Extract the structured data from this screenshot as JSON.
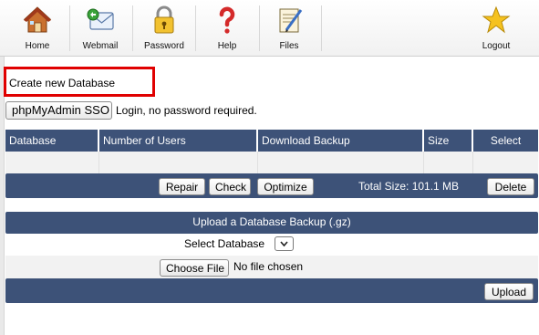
{
  "toolbar": {
    "items": [
      {
        "label": "Home",
        "icon": "home-icon"
      },
      {
        "label": "Webmail",
        "icon": "webmail-icon"
      },
      {
        "label": "Password",
        "icon": "padlock-icon"
      },
      {
        "label": "Help",
        "icon": "question-mark-icon"
      },
      {
        "label": "Files",
        "icon": "files-icon"
      },
      {
        "label": "Logout",
        "icon": "star-icon"
      }
    ]
  },
  "create": {
    "label": "Create new Database",
    "highlight_color": "#e00000"
  },
  "sso": {
    "button": "phpMyAdmin SSO",
    "note": "Login, no password required."
  },
  "table": {
    "columns": [
      "Database",
      "Number of Users",
      "Download Backup",
      "Size",
      "Select"
    ],
    "header_color": "#3d5278"
  },
  "actions": {
    "repair": "Repair",
    "check": "Check",
    "optimize": "Optimize",
    "total_size": "Total Size: 101.1 MB",
    "delete": "Delete"
  },
  "upload": {
    "title": "Upload a Database Backup (.gz)",
    "select_label": "Select Database",
    "choose_file": "Choose File",
    "no_file": "No file chosen",
    "upload_button": "Upload"
  }
}
